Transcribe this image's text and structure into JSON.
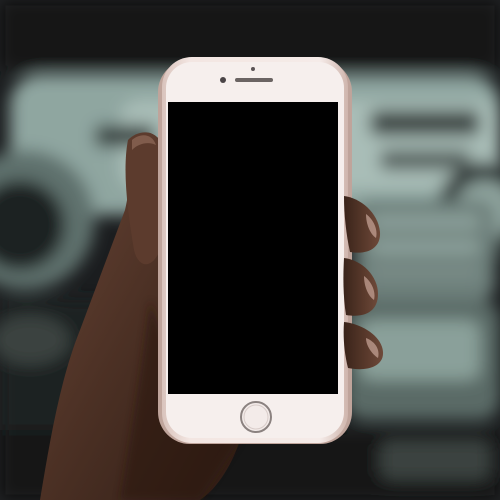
{
  "scene": {
    "subject": "hand-holding-smartphone",
    "setting": "car-interior-dashboard",
    "phone": {
      "model_look": "rose-gold-smartphone-with-home-button",
      "screen_state": "off"
    }
  },
  "colors": {
    "background_dark": "#1a1c1e",
    "dashboard_light": "#9fb4ae",
    "dashboard_mid": "#5f716d",
    "phone_body": "#ecdcd6",
    "phone_bezel": "#f7f0ee",
    "phone_screen": "#000000",
    "skin": "#4a2f22",
    "skin_highlight": "#6b4a3a"
  }
}
